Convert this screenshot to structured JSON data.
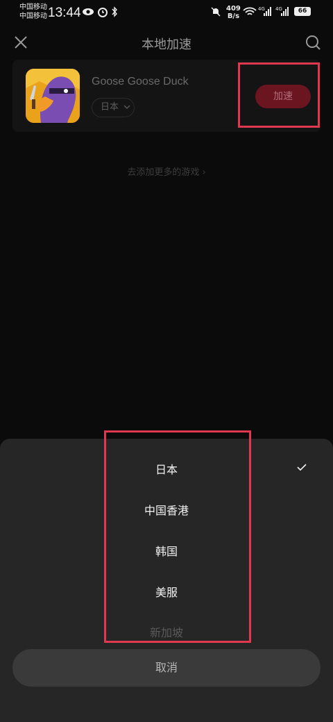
{
  "status_bar": {
    "carrier1": "中国移动",
    "carrier2": "中国移动",
    "time": "13:44",
    "speed_value": "409",
    "speed_unit": "B/s",
    "battery": "66"
  },
  "header": {
    "title": "本地加速"
  },
  "game": {
    "name": "Goose Goose Duck",
    "region": "日本",
    "boost_label": "加速"
  },
  "add_more": "去添加更多的游戏 ›",
  "sheet": {
    "options": [
      "日本",
      "中国香港",
      "韩国",
      "美服",
      "新加坡"
    ],
    "selected_index": 0,
    "cancel_label": "取消"
  },
  "colors": {
    "accent": "#6b1521",
    "highlight": "#e0394f"
  }
}
